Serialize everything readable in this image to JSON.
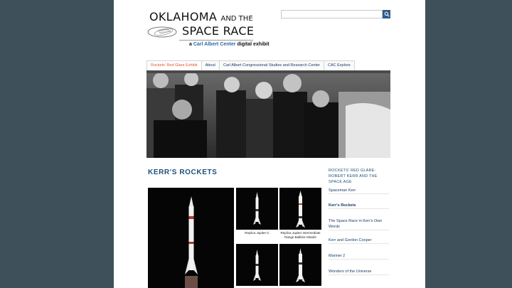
{
  "header": {
    "logo_line1_a": "OKLAHOMA",
    "logo_line1_b": "AND THE",
    "logo_line2": "SPACE RACE",
    "logo_sub_a": "a",
    "logo_sub_accent": "Carl Albert Center",
    "logo_sub_b": "digital exhibit"
  },
  "search": {
    "value": "",
    "placeholder": ""
  },
  "nav": {
    "tabs": [
      {
        "label": "Rockets' Red Glare Exhibit"
      },
      {
        "label": "About"
      },
      {
        "label": "Carl Albert Congressional Studies and Research Center"
      },
      {
        "label": "CAC Explore"
      }
    ]
  },
  "main": {
    "title": "KERR'S ROCKETS",
    "captions": [
      "Replica Jupiter-C",
      "Replica Jupiter Intermediate Range Ballistic Missile"
    ]
  },
  "sidebar": {
    "heading": "ROCKETS' RED GLARE: ROBERT KERR AND THE SPACE AGE",
    "items": [
      {
        "label": "Spaceman Kerr"
      },
      {
        "label": "Kerr's Rockets"
      },
      {
        "label": "The Space Race in Kerr's Own Words"
      },
      {
        "label": "Kerr and Gordon Cooper"
      },
      {
        "label": "Mariner 2"
      },
      {
        "label": "Wonders of the Universe"
      }
    ]
  },
  "colors": {
    "background": "#3e5059",
    "accent": "#1e4f7c",
    "active_tab": "#e2562b",
    "search_button": "#2f5d8a"
  },
  "icons": {
    "search": "search-icon"
  }
}
